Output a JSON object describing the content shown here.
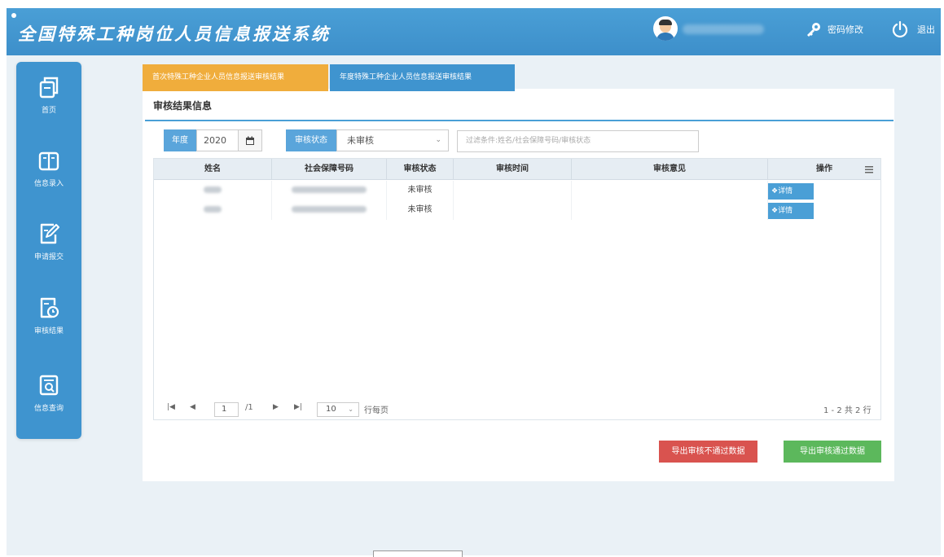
{
  "header": {
    "title": "全国特殊工种岗位人员信息报送系统",
    "password_label": "密码修改",
    "logout_label": "退出"
  },
  "sidebar": {
    "items": [
      {
        "label": "首页",
        "icon": "copy-icon"
      },
      {
        "label": "信息录入",
        "icon": "book-icon"
      },
      {
        "label": "申请报交",
        "icon": "edit-icon"
      },
      {
        "label": "审核结果",
        "icon": "document-clock-icon"
      },
      {
        "label": "信息查询",
        "icon": "document-search-icon"
      }
    ]
  },
  "tabs": [
    {
      "label": "首次特殊工种企业人员信息报送审核结果",
      "color": "#f0ad3c",
      "active": false
    },
    {
      "label": "年度特殊工种企业人员信息报送审核结果",
      "color": "#3f94cf",
      "active": true
    }
  ],
  "section": {
    "title": "审核结果信息"
  },
  "filters": {
    "year_label": "年度",
    "year_value": "2020",
    "status_label": "审核状态",
    "status_value": "未审核",
    "search_placeholder": "过滤条件:姓名/社会保障号码/审核状态"
  },
  "table": {
    "columns": [
      "姓名",
      "社会保障号码",
      "审核状态",
      "审核时间",
      "审核意见",
      "操作"
    ],
    "rows": [
      {
        "status": "未审核",
        "action": "详情"
      },
      {
        "status": "未审核",
        "action": "详情"
      }
    ]
  },
  "pager": {
    "page": "1",
    "total_pages": "/1",
    "page_size": "10",
    "per_page_label": "行每页",
    "summary": "1 - 2 共 2 行"
  },
  "actions": {
    "export_fail": "导出审核不通过数据",
    "export_pass": "导出审核通过数据"
  },
  "colors": {
    "header": "#4a9fd6",
    "sidebar": "#3f94cf",
    "tab_orange": "#f0ad3c",
    "danger": "#d9534f",
    "success": "#5cb85c"
  }
}
